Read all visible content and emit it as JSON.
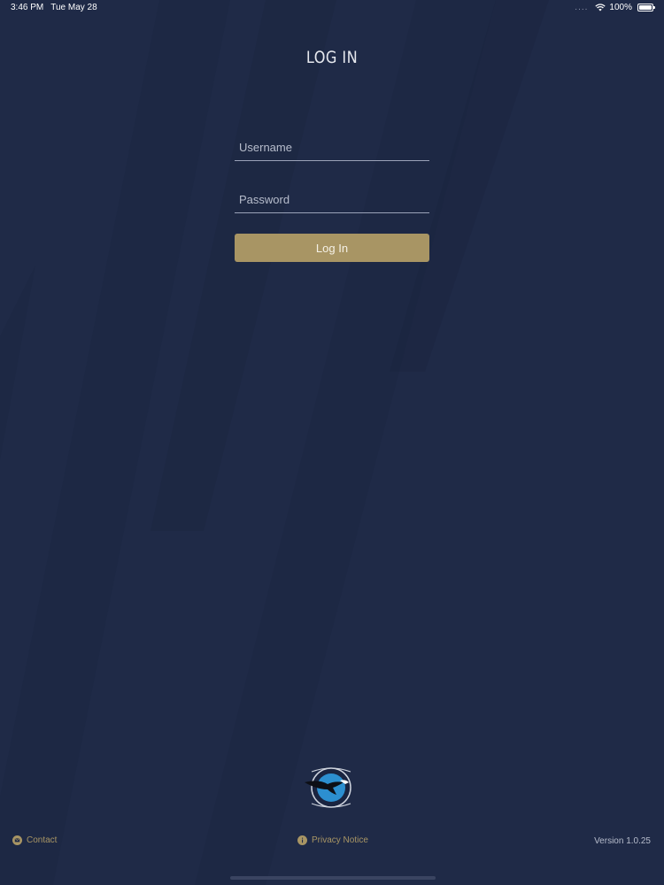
{
  "status_bar": {
    "time": "3:46 PM",
    "date": "Tue May 28",
    "signal": "....",
    "battery": "100%",
    "wifi_icon": "wifi-icon",
    "battery_icon": "battery-icon"
  },
  "login": {
    "title": "LOG IN",
    "username_placeholder": "Username",
    "username_value": "",
    "password_placeholder": "Password",
    "password_value": "",
    "button_label": "Log In"
  },
  "footer": {
    "contact_label": "Contact",
    "contact_icon": "mail-icon",
    "privacy_label": "Privacy Notice",
    "privacy_icon": "info-icon",
    "version": "Version 1.0.25"
  },
  "colors": {
    "background": "#1f2a47",
    "accent_gold": "#a89564",
    "field_underline": "#9aa2b8",
    "muted_text": "#b7bdcc"
  }
}
